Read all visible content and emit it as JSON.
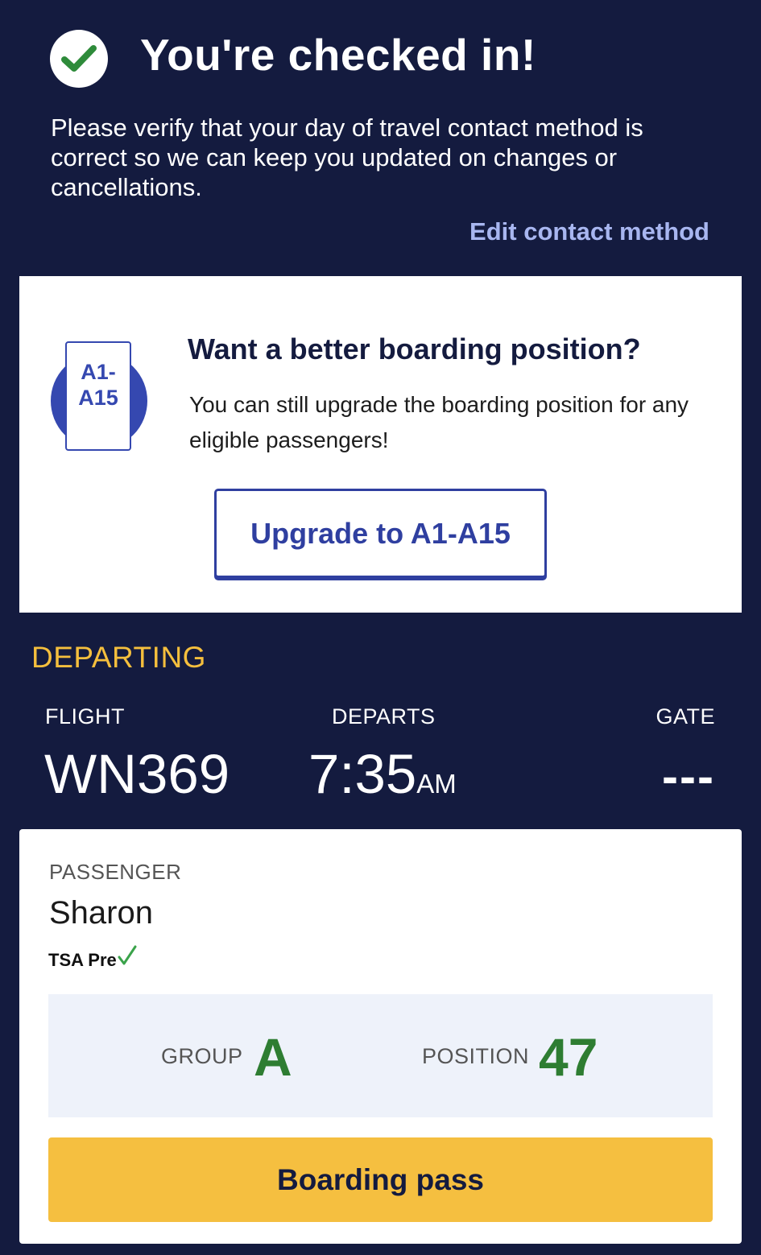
{
  "header": {
    "icon": "check-circle-icon",
    "title": "You're checked in!",
    "message": "Please verify that your day of travel contact method is correct so we can keep you updated on changes or cancellations.",
    "edit_link": "Edit contact method"
  },
  "upgrade": {
    "badge_icon": "boarding-position-badge-icon",
    "badge_text_line1": "A1-",
    "badge_text_line2": "A15",
    "title": "Want a better boarding position?",
    "description": "You can still upgrade the boarding position for any eligible passengers!",
    "button_label": "Upgrade to A1-A15"
  },
  "departing": {
    "section_label": "DEPARTING",
    "flight_label": "FLIGHT",
    "flight": "WN369",
    "departs_label": "DEPARTS",
    "time": "7:35",
    "ampm": "AM",
    "gate_label": "GATE",
    "gate": "---"
  },
  "passenger": {
    "label": "PASSENGER",
    "name": "Sharon",
    "tsa_text": "TSA Pre",
    "tsa_icon": "green-checkmark-icon",
    "group_label": "GROUP",
    "group": "A",
    "position_label": "POSITION",
    "position": "47",
    "boarding_button": "Boarding pass"
  },
  "colors": {
    "background": "#141b3f",
    "accent_yellow": "#f5bf40",
    "link": "#a8b6f0",
    "brand_blue": "#2f3fa0",
    "success_green": "#2e7d32"
  }
}
